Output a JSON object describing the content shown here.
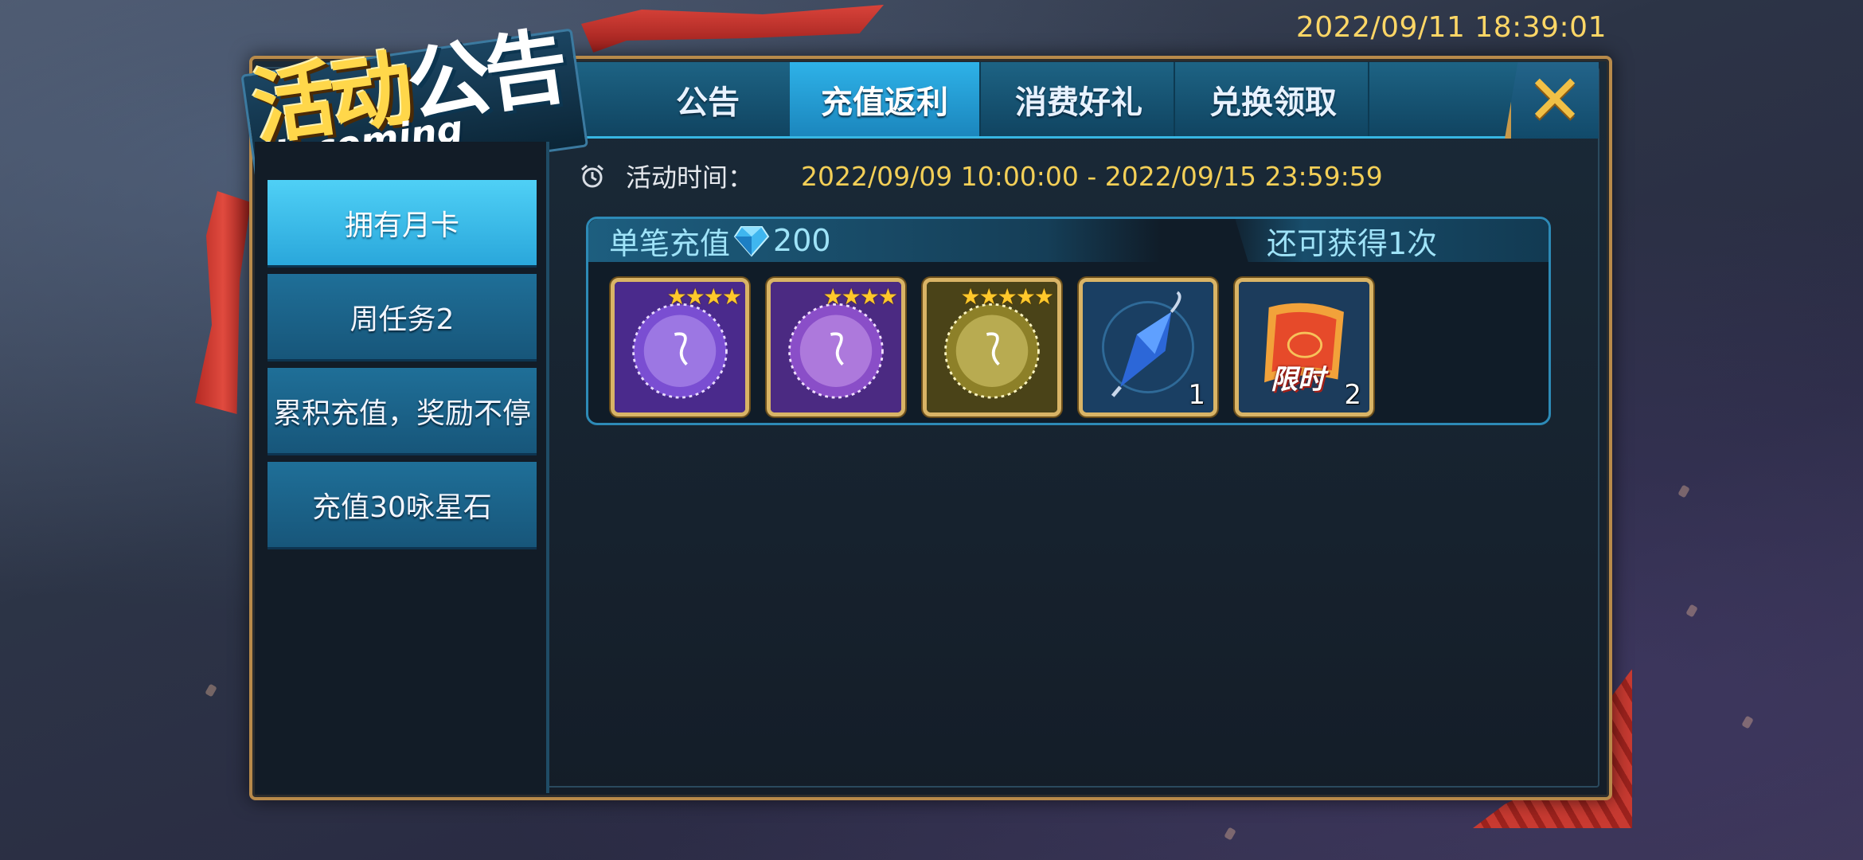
{
  "status_bar": {
    "datetime": "2022/09/11  18:39:01"
  },
  "logo": {
    "title_a": "活动",
    "title_b": "公告",
    "subtitle": "Upcoming Events"
  },
  "tabs": [
    {
      "label": "公告",
      "active": false
    },
    {
      "label": "充值返利",
      "active": true
    },
    {
      "label": "消费好礼",
      "active": false
    },
    {
      "label": "兑换领取",
      "active": false
    }
  ],
  "close": {
    "icon": "close-icon"
  },
  "sidebar": {
    "items": [
      {
        "label": "拥有月卡",
        "active": true
      },
      {
        "label": "周任务2",
        "active": false
      },
      {
        "label": "累积充值，奖励不停",
        "active": false
      },
      {
        "label": "充值30咏星石",
        "active": false
      }
    ]
  },
  "event": {
    "time_label": "活动时间：",
    "time_range": "2022/09/09 10:00:00 - 2022/09/15 23:59:59"
  },
  "reward": {
    "title": "单笔充值",
    "currency_icon": "gem-icon",
    "amount": "200",
    "remaining": "还可获得1次",
    "items": [
      {
        "name": "purple-summon-orb",
        "stars": 4,
        "count": ""
      },
      {
        "name": "purple-summon-orb",
        "stars": 4,
        "count": ""
      },
      {
        "name": "gold-summon-orb",
        "stars": 5,
        "count": ""
      },
      {
        "name": "blue-umbrella",
        "stars": 0,
        "count": "1"
      },
      {
        "name": "limited-scroll",
        "stars": 0,
        "count": "2",
        "tag": "限时"
      }
    ]
  },
  "colors": {
    "accent_blue": "#2eb2e8",
    "gold": "#f3cf57",
    "frame_gold": "#b88a4a"
  }
}
